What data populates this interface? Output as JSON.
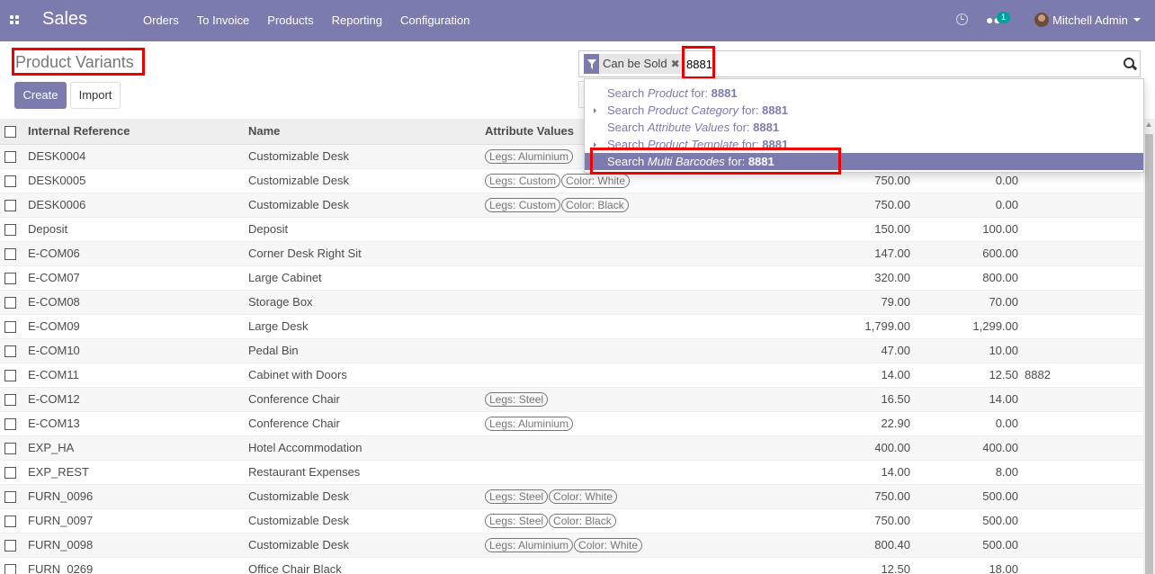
{
  "navbar": {
    "app_title": "Sales",
    "menu": [
      "Orders",
      "To Invoice",
      "Products",
      "Reporting",
      "Configuration"
    ],
    "chat_badge": "1",
    "user_name": "Mitchell Admin",
    "bg_color": "#7c7bad"
  },
  "control_panel": {
    "title": "Product Variants",
    "create_label": "Create",
    "import_label": "Import"
  },
  "search": {
    "facet_label": "Can be Sold",
    "facet_remove": "✖",
    "query": "8881",
    "suggestions": [
      {
        "prefix": "Search ",
        "field": "Product",
        "suffix": " for: ",
        "value": "8881",
        "expandable": false
      },
      {
        "prefix": "Search ",
        "field": "Product Category",
        "suffix": " for: ",
        "value": "8881",
        "expandable": true
      },
      {
        "prefix": "Search ",
        "field": "Attribute Values",
        "suffix": " for: ",
        "value": "8881",
        "expandable": false
      },
      {
        "prefix": "Search ",
        "field": "Product Template",
        "suffix": " for: ",
        "value": "8881",
        "expandable": true
      },
      {
        "prefix": "Search ",
        "field": "Multi Barcodes",
        "suffix": " for: ",
        "value": "8881",
        "expandable": false,
        "active": true
      }
    ]
  },
  "table": {
    "headers": [
      "Internal Reference",
      "Name",
      "Attribute Values",
      "",
      "",
      ""
    ],
    "rows": [
      {
        "ref": "DESK0004",
        "name": "Customizable Desk",
        "attrs": [
          "Legs: Aluminium"
        ],
        "price": "",
        "cost": "",
        "barcode": ""
      },
      {
        "ref": "DESK0005",
        "name": "Customizable Desk",
        "attrs": [
          "Legs: Custom",
          "Color: White"
        ],
        "price": "750.00",
        "cost": "0.00",
        "barcode": ""
      },
      {
        "ref": "DESK0006",
        "name": "Customizable Desk",
        "attrs": [
          "Legs: Custom",
          "Color: Black"
        ],
        "price": "750.00",
        "cost": "0.00",
        "barcode": ""
      },
      {
        "ref": "Deposit",
        "name": "Deposit",
        "attrs": [],
        "price": "150.00",
        "cost": "100.00",
        "barcode": ""
      },
      {
        "ref": "E-COM06",
        "name": "Corner Desk Right Sit",
        "attrs": [],
        "price": "147.00",
        "cost": "600.00",
        "barcode": ""
      },
      {
        "ref": "E-COM07",
        "name": "Large Cabinet",
        "attrs": [],
        "price": "320.00",
        "cost": "800.00",
        "barcode": ""
      },
      {
        "ref": "E-COM08",
        "name": "Storage Box",
        "attrs": [],
        "price": "79.00",
        "cost": "70.00",
        "barcode": ""
      },
      {
        "ref": "E-COM09",
        "name": "Large Desk",
        "attrs": [],
        "price": "1,799.00",
        "cost": "1,299.00",
        "barcode": ""
      },
      {
        "ref": "E-COM10",
        "name": "Pedal Bin",
        "attrs": [],
        "price": "47.00",
        "cost": "10.00",
        "barcode": ""
      },
      {
        "ref": "E-COM11",
        "name": "Cabinet with Doors",
        "attrs": [],
        "price": "14.00",
        "cost": "12.50",
        "barcode": "8882"
      },
      {
        "ref": "E-COM12",
        "name": "Conference Chair",
        "attrs": [
          "Legs: Steel"
        ],
        "price": "16.50",
        "cost": "14.00",
        "barcode": ""
      },
      {
        "ref": "E-COM13",
        "name": "Conference Chair",
        "attrs": [
          "Legs: Aluminium"
        ],
        "price": "22.90",
        "cost": "0.00",
        "barcode": ""
      },
      {
        "ref": "EXP_HA",
        "name": "Hotel Accommodation",
        "attrs": [],
        "price": "400.00",
        "cost": "400.00",
        "barcode": ""
      },
      {
        "ref": "EXP_REST",
        "name": "Restaurant Expenses",
        "attrs": [],
        "price": "14.00",
        "cost": "8.00",
        "barcode": ""
      },
      {
        "ref": "FURN_0096",
        "name": "Customizable Desk",
        "attrs": [
          "Legs: Steel",
          "Color: White"
        ],
        "price": "750.00",
        "cost": "500.00",
        "barcode": ""
      },
      {
        "ref": "FURN_0097",
        "name": "Customizable Desk",
        "attrs": [
          "Legs: Steel",
          "Color: Black"
        ],
        "price": "750.00",
        "cost": "500.00",
        "barcode": ""
      },
      {
        "ref": "FURN_0098",
        "name": "Customizable Desk",
        "attrs": [
          "Legs: Aluminium",
          "Color: White"
        ],
        "price": "800.40",
        "cost": "500.00",
        "barcode": ""
      },
      {
        "ref": "FURN_0269",
        "name": "Office Chair Black",
        "attrs": [],
        "price": "12.50",
        "cost": "18.00",
        "barcode": ""
      }
    ]
  }
}
